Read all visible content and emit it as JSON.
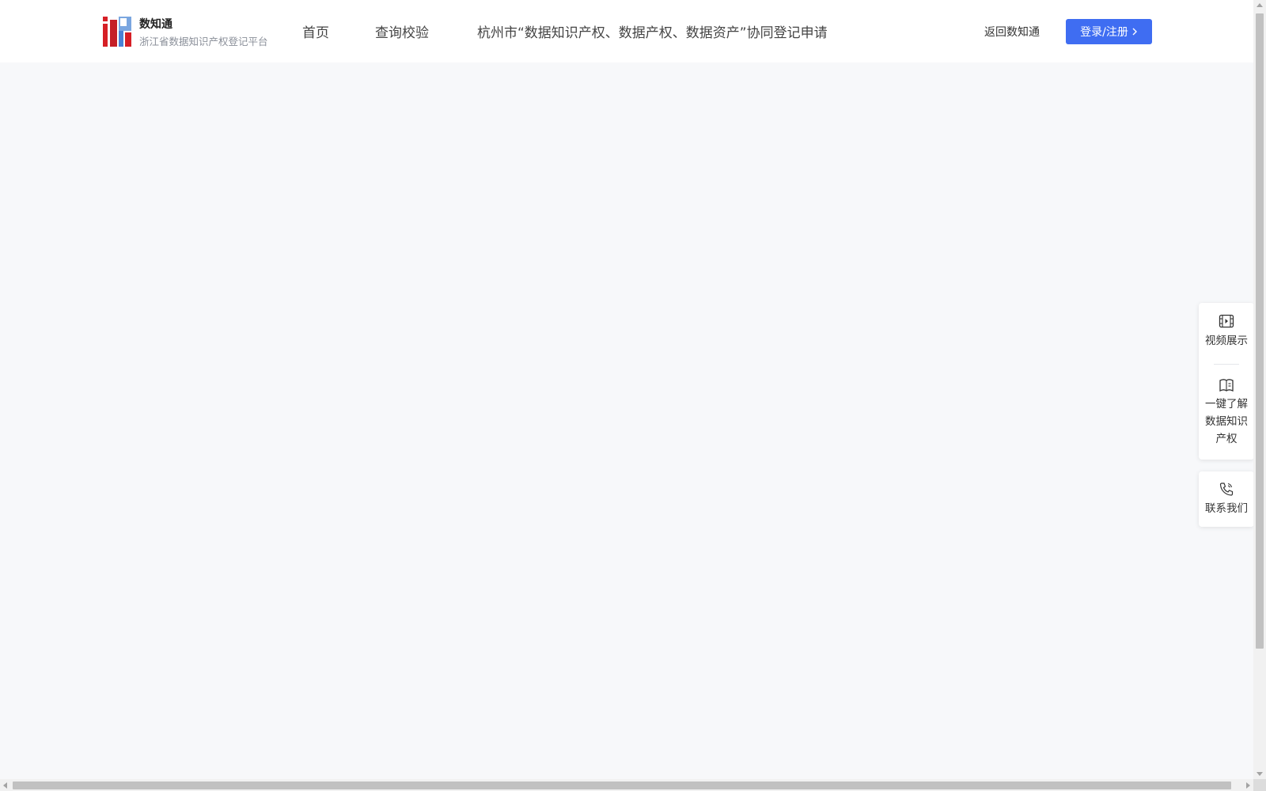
{
  "header": {
    "brand_title": "数知通",
    "brand_subtitle": "浙江省数据知识产权登记平台",
    "nav": {
      "home": "首页",
      "query": "查询校验",
      "apply": "杭州市“数据知识产权、数据产权、数据资产”协同登记申请"
    },
    "return_link": "返回数知通",
    "login_label": "登录/注册"
  },
  "side_panel": {
    "video": {
      "label": "视频展示",
      "icon": "video-icon"
    },
    "learn": {
      "label_lines": [
        "一键了解",
        "数据知识",
        "产权"
      ],
      "icon": "book-icon"
    },
    "contact": {
      "label": "联系我们",
      "icon": "phone-icon"
    }
  },
  "colors": {
    "accent": "#3f6df2",
    "background": "#f7f8fa",
    "header": "#ffffff"
  }
}
